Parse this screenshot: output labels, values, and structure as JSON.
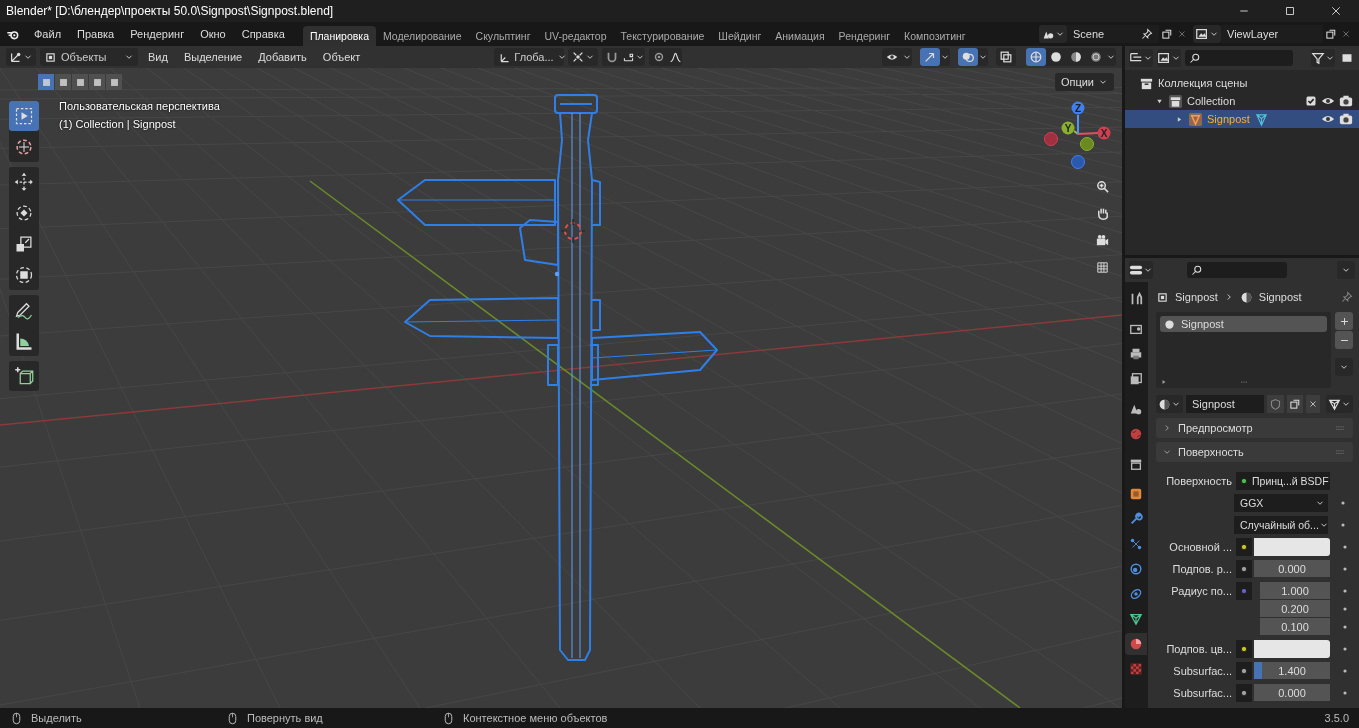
{
  "window": {
    "title": "Blender* [D:\\блендер\\проекты 50.0\\Signpost\\Signpost.blend]"
  },
  "menu": [
    {
      "label": "Файл"
    },
    {
      "label": "Правка"
    },
    {
      "label": "Рендеринг"
    },
    {
      "label": "Окно"
    },
    {
      "label": "Справка"
    }
  ],
  "workspaces": [
    {
      "label": "Планировка",
      "selected": true
    },
    {
      "label": "Моделирование",
      "selected": false
    },
    {
      "label": "Скульптинг",
      "selected": false
    },
    {
      "label": "UV-редактор",
      "selected": false
    },
    {
      "label": "Текстурирование",
      "selected": false
    },
    {
      "label": "Шейдинг",
      "selected": false
    },
    {
      "label": "Анимация",
      "selected": false
    },
    {
      "label": "Рендеринг",
      "selected": false
    },
    {
      "label": "Композитинг",
      "selected": false
    }
  ],
  "scene": {
    "value": "Scene"
  },
  "view_layer": {
    "value": "ViewLayer"
  },
  "viewport": {
    "mode": "Объекты",
    "menus": [
      {
        "label": "Вид"
      },
      {
        "label": "Выделение"
      },
      {
        "label": "Добавить"
      },
      {
        "label": "Объект"
      }
    ],
    "orientation": "Глоба...",
    "snap_toggles": [
      {
        "kind": "snap",
        "on": false
      },
      {
        "kind": "proportional",
        "on": false
      }
    ],
    "overlay_toggles": [
      {
        "kind": "visibility",
        "on": false
      },
      {
        "kind": "gizmo",
        "on": true
      },
      {
        "kind": "overlay",
        "on": true
      },
      {
        "kind": "xray",
        "on": false
      }
    ],
    "shading": [
      {
        "kind": "wireframe",
        "selected": true
      },
      {
        "kind": "solid",
        "selected": false
      },
      {
        "kind": "material",
        "selected": false
      },
      {
        "kind": "rendered",
        "selected": false
      }
    ],
    "select_modes": [
      {
        "selected": true
      },
      {
        "selected": false
      },
      {
        "selected": false
      },
      {
        "selected": false
      },
      {
        "selected": false
      }
    ],
    "options": "Опции",
    "view_name": "Пользовательская перспектива",
    "context": "(1) Collection | Signpost",
    "tool_groups": [
      [
        {
          "kind": "select",
          "selected": true
        },
        {
          "kind": "cursor",
          "selected": false
        }
      ],
      [
        {
          "kind": "move",
          "selected": false
        },
        {
          "kind": "rotate",
          "selected": false
        },
        {
          "kind": "scale",
          "selected": false
        },
        {
          "kind": "transform",
          "selected": false
        }
      ],
      [
        {
          "kind": "annotate",
          "selected": false
        },
        {
          "kind": "measure",
          "selected": false
        }
      ],
      [
        {
          "kind": "add_cube",
          "selected": false
        }
      ]
    ],
    "gizmo_labels": [
      "X",
      "Y",
      "Z"
    ]
  },
  "outliner": {
    "items": [
      {
        "label": "Коллекция сцены",
        "kind": "scene_collection",
        "children": [
          {
            "label": "Collection",
            "kind": "collection",
            "expanded": true,
            "checked": true,
            "children": [
              {
                "label": "Signpost",
                "kind": "object",
                "expanded": false,
                "selected": true
              }
            ]
          }
        ]
      }
    ]
  },
  "properties": {
    "breadcrumb": [
      "Signpost",
      "Signpost"
    ],
    "tab_groups": [
      [
        {
          "kind": "tool",
          "selected": false
        }
      ],
      [
        {
          "kind": "render",
          "selected": false
        },
        {
          "kind": "output",
          "selected": false
        },
        {
          "kind": "view_layer",
          "selected": false
        }
      ],
      [
        {
          "kind": "scene",
          "selected": false
        },
        {
          "kind": "world",
          "selected": false
        }
      ],
      [
        {
          "kind": "collection",
          "selected": false
        }
      ],
      [
        {
          "kind": "object",
          "selected": false
        },
        {
          "kind": "modifiers",
          "selected": false
        },
        {
          "kind": "particles",
          "selected": false
        },
        {
          "kind": "physics",
          "selected": false
        },
        {
          "kind": "constraints",
          "selected": false
        },
        {
          "kind": "data",
          "selected": false
        },
        {
          "kind": "material",
          "selected": true
        },
        {
          "kind": "texture",
          "selected": false
        }
      ]
    ],
    "slots": [
      {
        "label": "Signpost",
        "selected": true
      }
    ],
    "material": "Signpost",
    "panels": [
      {
        "label": "Предпросмотр",
        "expanded": false
      },
      {
        "label": "Поверхность",
        "expanded": true
      }
    ],
    "rows": [
      {
        "kind": "link",
        "label": "Поверхность",
        "value": "Принц...й BSDF",
        "color": "#4fbf4f"
      },
      {
        "kind": "dropdown",
        "value": "GGX"
      },
      {
        "kind": "dropdown",
        "value": "Случайный об..."
      },
      {
        "kind": "color",
        "label": "Основной ...",
        "color": "#c7c729"
      },
      {
        "kind": "number",
        "label": "Подпов. р...",
        "color": "#a1a1a1",
        "values": [
          "0.000"
        ]
      },
      {
        "kind": "number",
        "label": "Радиус по...",
        "color": "#6363c7",
        "values": [
          "1.000",
          "0.200",
          "0.100"
        ]
      },
      {
        "kind": "color",
        "label": "Подпов. цв...",
        "color": "#c7c729"
      },
      {
        "kind": "number",
        "label": "Subsurfac...",
        "color": "#a1a1a1",
        "values": [
          "1.400"
        ],
        "level": 0.1
      },
      {
        "kind": "number",
        "label": "Subsurfac...",
        "color": "#a1a1a1",
        "values": [
          "0.000"
        ]
      }
    ]
  },
  "status_bar": {
    "items": [
      {
        "label": "Выделить"
      },
      {
        "label": "Повернуть вид"
      },
      {
        "label": "Контекстное меню объектов"
      }
    ],
    "version": "3.5.0"
  }
}
